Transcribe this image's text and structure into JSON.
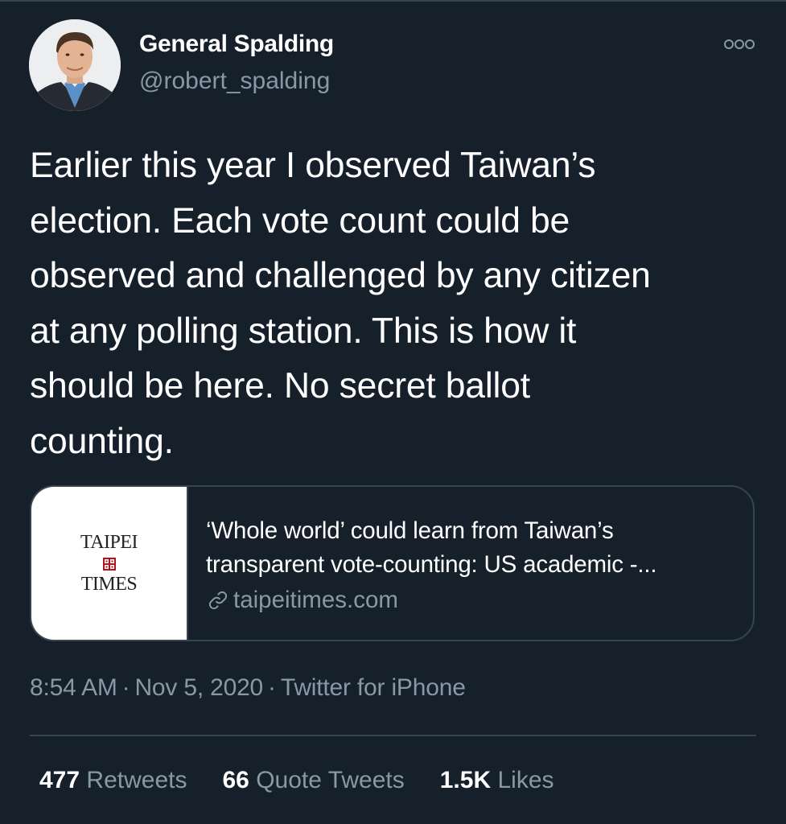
{
  "author": {
    "name": "General Spalding",
    "handle": "@robert_spalding"
  },
  "tweet": {
    "lines": [
      "Earlier this year I observed Taiwan’s",
      "election. Each vote count could be",
      "observed and challenged by any citizen",
      "at any polling station. This is how it",
      "should be here. No secret ballot",
      "counting."
    ]
  },
  "card": {
    "logo_line1": "TAIPEI",
    "logo_line2": "TIMES",
    "title_line1": "‘Whole world’ could learn from Taiwan’s",
    "title_line2": "transparent vote-counting: US academic -...",
    "domain": "taipeitimes.com"
  },
  "meta": {
    "time": "8:54 AM",
    "date": "Nov 5, 2020",
    "source": "Twitter for iPhone",
    "separator": "·"
  },
  "stats": {
    "retweets_count": "477",
    "retweets_label": "Retweets",
    "quotes_count": "66",
    "quotes_label": "Quote Tweets",
    "likes_count": "1.5K",
    "likes_label": "Likes"
  },
  "colors": {
    "background": "#15202b",
    "secondary_text": "#8899a6",
    "border": "#38444d",
    "logo_seal": "#b3121d"
  }
}
